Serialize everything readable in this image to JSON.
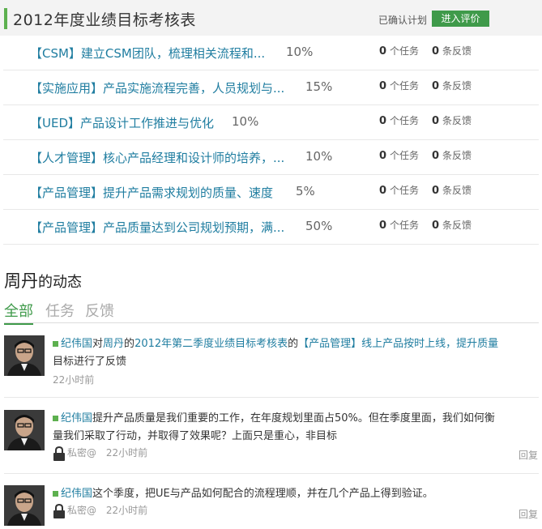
{
  "header": {
    "title": "2012年度业绩目标考核表",
    "status": "已确认计划",
    "eval_button": "进入评价"
  },
  "goals": [
    {
      "text": "【CSM】建立CSM团队，梳理相关流程和...",
      "percent": "10%",
      "tasks": "0",
      "tasks_label": "个任务",
      "feedback": "0",
      "feedback_label": "条反馈"
    },
    {
      "text": "【实施应用】产品实施流程完善，人员规划与...",
      "percent": "15%",
      "tasks": "0",
      "tasks_label": "个任务",
      "feedback": "0",
      "feedback_label": "条反馈"
    },
    {
      "text": "【UED】产品设计工作推进与优化",
      "percent": "10%",
      "tasks": "0",
      "tasks_label": "个任务",
      "feedback": "0",
      "feedback_label": "条反馈"
    },
    {
      "text": "【人才管理】核心产品经理和设计师的培养，...",
      "percent": "10%",
      "tasks": "0",
      "tasks_label": "个任务",
      "feedback": "0",
      "feedback_label": "条反馈"
    },
    {
      "text": "【产品管理】提升产品需求规划的质量、速度",
      "percent": "5%",
      "tasks": "0",
      "tasks_label": "个任务",
      "feedback": "0",
      "feedback_label": "条反馈"
    },
    {
      "text": "【产品管理】产品质量达到公司规划预期，满...",
      "percent": "50%",
      "tasks": "0",
      "tasks_label": "个任务",
      "feedback": "0",
      "feedback_label": "条反馈"
    }
  ],
  "activity": {
    "user": "周丹",
    "suffix": "的动态",
    "tabs": [
      "全部",
      "任务",
      "反馈"
    ]
  },
  "feed": [
    {
      "author": "纪伟国",
      "p1": "对",
      "target_user": "周丹",
      "p2": "的",
      "table": "2012年第二季度业绩目标考核表",
      "p3": "的",
      "goal": "【产品管理】线上产品按时上线，提升质量",
      "line2": "目标进行了反馈",
      "time": "22小时前"
    },
    {
      "author": "纪伟国",
      "line1": "提升产品质量是我们重要的工作，在年度规划里面占50%。但在季度里面，我们如何衡",
      "line2": "量我们采取了行动，并取得了效果呢？上面只是重心，非目标",
      "privacy": "私密@",
      "time": "22小时前",
      "reply": "回复"
    },
    {
      "author": "纪伟国",
      "text": "这个季度，把UE与产品如何配合的流程理顺，并在几个产品上得到验证。",
      "privacy": "私密@",
      "time": "22小时前",
      "reply": "回复"
    }
  ],
  "colors": {
    "accent_green": "#3f9a4a",
    "link_blue": "#1f7da0"
  }
}
